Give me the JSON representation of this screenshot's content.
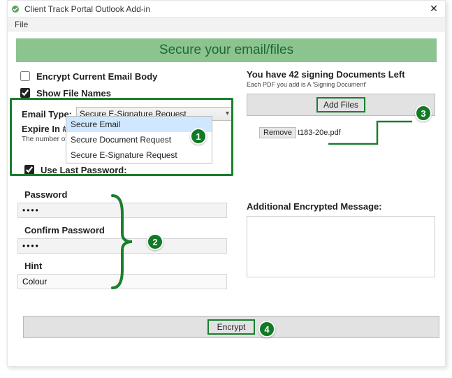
{
  "window": {
    "title": "Client Track Portal Outlook Add-in",
    "close_glyph": "✕"
  },
  "menu": {
    "file": "File"
  },
  "banner": "Secure your email/files",
  "left": {
    "encrypt_body_label": "Encrypt Current Email Body",
    "encrypt_body_checked": false,
    "show_filenames_label": "Show File Names",
    "show_filenames_checked": true,
    "email_type_label": "Email Type:",
    "email_type_selected": "Secure E-Signature Request",
    "email_type_options": [
      "Secure Email",
      "Secure Document Request",
      "Secure E-Signature Request"
    ],
    "expire_label_visible": "Expire In # D",
    "expire_hint_visible": "The number of d",
    "use_last_pw_label": "Use Last Password:",
    "use_last_pw_checked": true,
    "password_label": "Password",
    "password_value": "••••",
    "confirm_label": "Confirm Password",
    "confirm_value": "••••",
    "hint_label": "Hint",
    "hint_value": "Colour"
  },
  "right": {
    "docs_left_text": "You have 42 signing Documents Left",
    "docs_left_sub": "Each PDF you add is A 'Signing Document'",
    "add_files_label": "Add Files",
    "remove_label": "Remove",
    "file_name": "t183-20e.pdf",
    "addl_label": "Additional Encrypted Message:",
    "addl_value": ""
  },
  "encrypt_label": "Encrypt",
  "callouts": {
    "c1": "1",
    "c2": "2",
    "c3": "3",
    "c4": "4"
  }
}
